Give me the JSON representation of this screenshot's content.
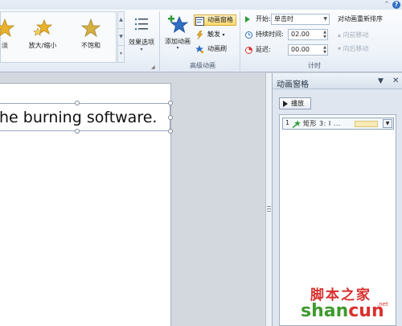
{
  "ribbon": {
    "gallery": {
      "items": [
        {
          "label": "淡",
          "icon": "star-effect-icon"
        },
        {
          "label": "放大/缩小",
          "icon": "star-grow-shrink-icon"
        },
        {
          "label": "不饱和",
          "icon": "star-desaturate-icon"
        }
      ]
    },
    "effect_options": {
      "label": "效果选项"
    },
    "add_animation": {
      "label": "添加动画"
    },
    "animation_pane_button": {
      "label": "动画窗格"
    },
    "trigger_button": {
      "label": "触发"
    },
    "animation_painter": {
      "label": "动画刷"
    },
    "advanced_group_label": "高级动画",
    "timing": {
      "start_label": "开始:",
      "start_value": "单击时",
      "duration_label": "持续时间:",
      "duration_value": "02.00",
      "delay_label": "延迟:",
      "delay_value": "00.00",
      "group_label": "计时"
    },
    "reorder": {
      "title": "对动画重新排序",
      "move_earlier": "向前移动",
      "move_later": "向后移动"
    }
  },
  "slide": {
    "text": "he burning software."
  },
  "animation_pane": {
    "title": "动画窗格",
    "play_label": "播放",
    "items": [
      {
        "number": "1",
        "name": "矩形 3: I ..."
      }
    ]
  },
  "watermark": {
    "top": "脚本之家",
    "bottom_green": "shan",
    "bottom_red": "cun",
    "small": ".net"
  },
  "colors": {
    "ribbon_bg": "#eef3f9",
    "active_button": "#ffd86b",
    "pane_bg": "#dfe6ef",
    "timeline_bar": "#f9ebb5",
    "watermark_red": "#d9302f",
    "watermark_green": "#3f9a2e"
  }
}
